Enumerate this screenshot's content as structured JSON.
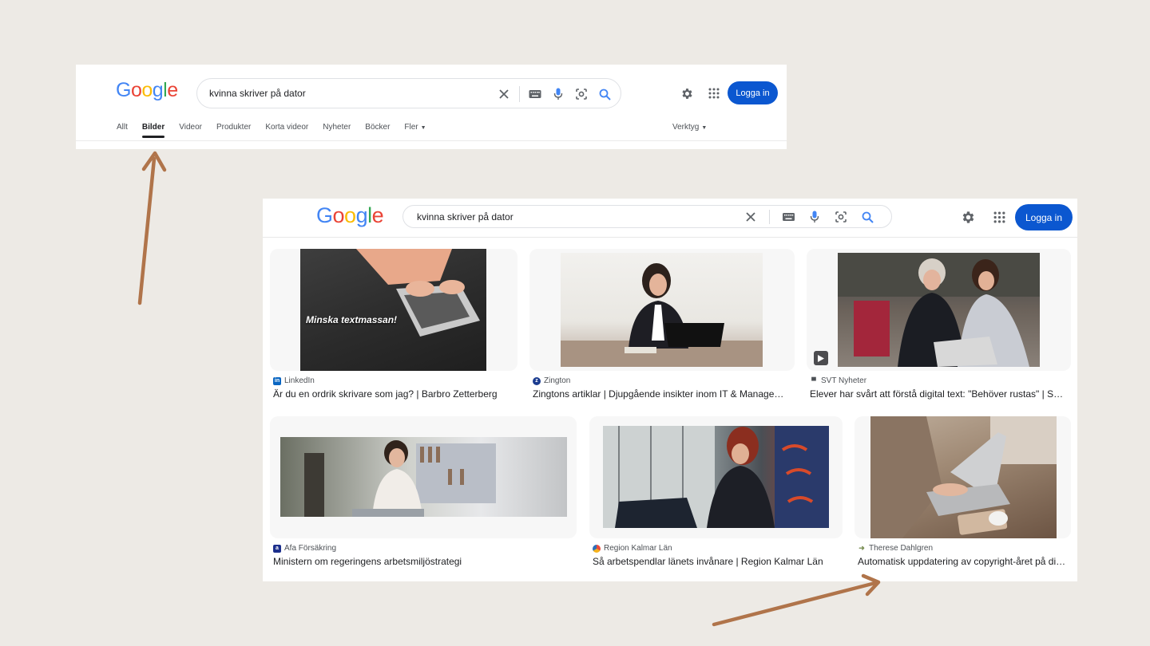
{
  "search": {
    "query": "kvinna skriver på dator"
  },
  "logo": [
    "G",
    "o",
    "o",
    "g",
    "l",
    "e"
  ],
  "login_label": "Logga in",
  "tabs": [
    {
      "label": "Allt",
      "active": false
    },
    {
      "label": "Bilder",
      "active": true
    },
    {
      "label": "Videor",
      "active": false
    },
    {
      "label": "Produkter",
      "active": false
    },
    {
      "label": "Korta videor",
      "active": false
    },
    {
      "label": "Nyheter",
      "active": false
    },
    {
      "label": "Böcker",
      "active": false
    },
    {
      "label": "Fler",
      "active": false
    }
  ],
  "tools_label": "Verktyg",
  "results": [
    {
      "source": "LinkedIn",
      "title": "Är du en ordrik skrivare som jag? | Barbro Zetterberg",
      "overlay": "Minska textmassan!"
    },
    {
      "source": "Zington",
      "title": "Zingtons artiklar | Djupgående insikter inom IT & Management"
    },
    {
      "source": "SVT Nyheter",
      "title": "Elever har svårt att förstå digital text: \"Behöver rustas\" | SVT Nyheter"
    },
    {
      "source": "Afa Försäkring",
      "title": "Ministern om regeringens arbetsmiljöstrategi"
    },
    {
      "source": "Region Kalmar Län",
      "title": "Så arbetspendlar länets invånare | Region Kalmar Län"
    },
    {
      "source": "Therese Dahlgren",
      "title": "Automatisk uppdatering av copyright-året på din webbplats"
    }
  ],
  "colors": {
    "background": "#edeae5",
    "login_button": "#0b57d0",
    "annotation_arrow": "#b0744a",
    "google_blue": "#4285f4",
    "google_red": "#ea4335",
    "google_yellow": "#fbbc05",
    "google_green": "#34a853"
  },
  "icons": [
    "clear-icon",
    "keyboard-icon",
    "microphone-icon",
    "google-lens-icon",
    "search-icon",
    "settings-gear-icon",
    "apps-grid-icon",
    "play-icon"
  ]
}
